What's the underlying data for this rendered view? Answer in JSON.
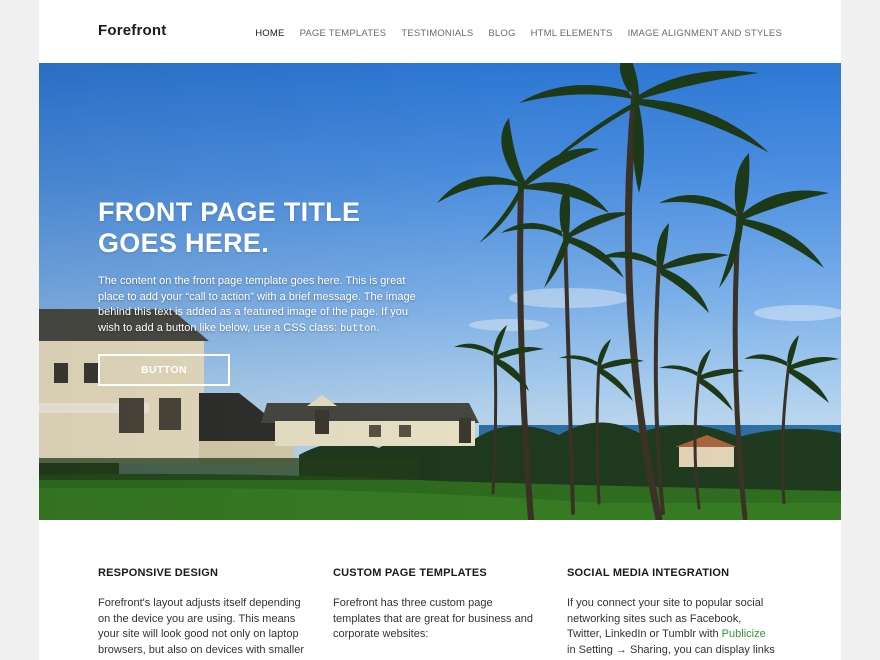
{
  "site": {
    "title": "Forefront"
  },
  "nav": {
    "items": [
      {
        "label": "HOME",
        "active": true
      },
      {
        "label": "PAGE TEMPLATES",
        "active": false
      },
      {
        "label": "TESTIMONIALS",
        "active": false
      },
      {
        "label": "BLOG",
        "active": false
      },
      {
        "label": "HTML ELEMENTS",
        "active": false
      },
      {
        "label": "IMAGE ALIGNMENT AND STYLES",
        "active": false
      }
    ]
  },
  "hero": {
    "title": "FRONT PAGE TITLE GOES HERE.",
    "text_before_code": "The content on the front page template goes here. This is great place to add your “call to action” with a brief message. The image behind this text is added as a featured image of the page. If you wish to add a button like below, use a CSS class: ",
    "code": "button",
    "text_after_code": ".",
    "button_label": "BUTTON"
  },
  "features": [
    {
      "title": "RESPONSIVE DESIGN",
      "text": "Forefront's layout adjusts itself depending on the device you are using. This means your site will look good not only on laptop browsers, but also on devices with smaller"
    },
    {
      "title": "CUSTOM PAGE TEMPLATES",
      "text": "Forefront has three custom page templates that are great for business and corporate websites:"
    },
    {
      "title": "SOCIAL MEDIA INTEGRATION",
      "text_before_link": "If you connect your site to popular social networking sites such as Facebook, Twitter, LinkedIn or Tumblr with ",
      "link": "Publicize",
      "text_after_link": " in Setting → Sharing, you can display links to your"
    }
  ],
  "colors": {
    "background": "#eff0ef",
    "link": "#2d9a2f",
    "text": "#333333"
  }
}
